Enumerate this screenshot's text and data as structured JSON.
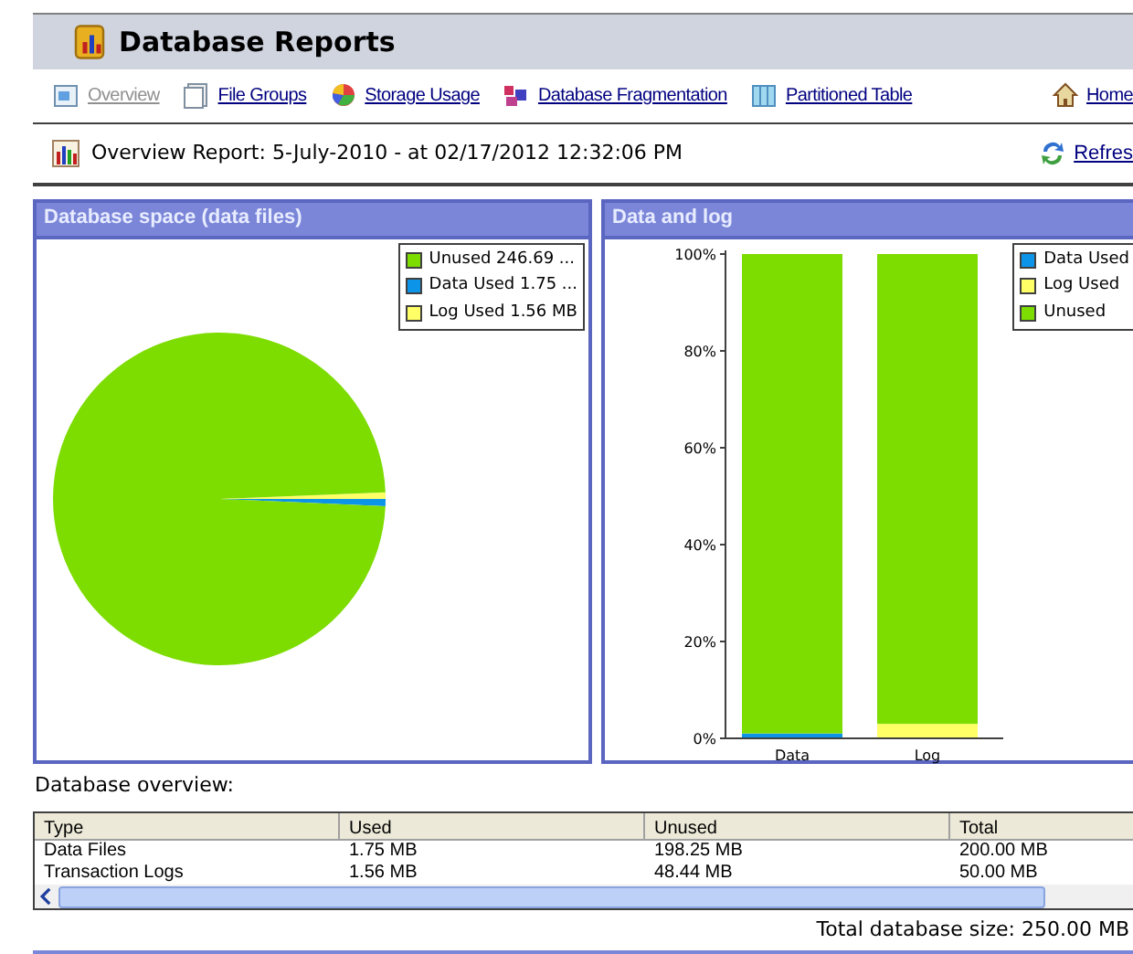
{
  "header": {
    "title": "Database Reports"
  },
  "nav": [
    {
      "label": "Overview",
      "selected": true,
      "kind": "overview"
    },
    {
      "label": "File Groups",
      "selected": false,
      "kind": "filegroups"
    },
    {
      "label": "Storage Usage",
      "selected": false,
      "kind": "storage"
    },
    {
      "label": "Database Fragmentation",
      "selected": false,
      "kind": "fragmentation"
    },
    {
      "label": "Partitioned Table",
      "selected": false,
      "kind": "partitioned"
    },
    {
      "label": "Home",
      "selected": false,
      "kind": "home"
    }
  ],
  "report": {
    "title": "Overview Report: 5-July-2010 - at 02/17/2012 12:32:06 PM",
    "refresh": "Refres"
  },
  "panels": [
    {
      "title": "Database space (data files)",
      "chart_data": {
        "type": "pie",
        "categories": [
          "Unused 246.69 ...",
          "Data Used 1.75 ...",
          "Log Used 1.56 MB"
        ],
        "values": [
          246.69,
          1.75,
          1.56
        ],
        "colors": [
          "#7ddc00",
          "#0c94e8",
          "#ffff66"
        ]
      }
    },
    {
      "title": "Data and log",
      "chart_data": {
        "type": "bar",
        "stacked": true,
        "categories": [
          "Data",
          "Log"
        ],
        "ylim": [
          0,
          100
        ],
        "yticks": [
          {
            "value": 0,
            "label": "0%"
          },
          {
            "value": 20,
            "label": "20%"
          },
          {
            "value": 40,
            "label": "40%"
          },
          {
            "value": 60,
            "label": "60%"
          },
          {
            "value": 80,
            "label": "80%"
          },
          {
            "value": 100,
            "label": "100%"
          }
        ],
        "series": [
          {
            "name": "Data Used",
            "color": "#0c94e8",
            "values": [
              1,
              0
            ]
          },
          {
            "name": "Log Used",
            "color": "#ffff66",
            "values": [
              0,
              3
            ]
          },
          {
            "name": "Unused",
            "color": "#7ddc00",
            "values": [
              99,
              97
            ]
          }
        ]
      }
    }
  ],
  "overview": {
    "title": "Database overview:",
    "columns": [
      "Type",
      "Used",
      "Unused",
      "Total"
    ],
    "rows": [
      [
        "Data Files",
        "1.75 MB",
        "198.25 MB",
        "200.00 MB"
      ],
      [
        "Transaction Logs",
        "1.56 MB",
        "48.44 MB",
        "50.00 MB"
      ]
    ],
    "total": "Total database size: 250.00 MB"
  }
}
